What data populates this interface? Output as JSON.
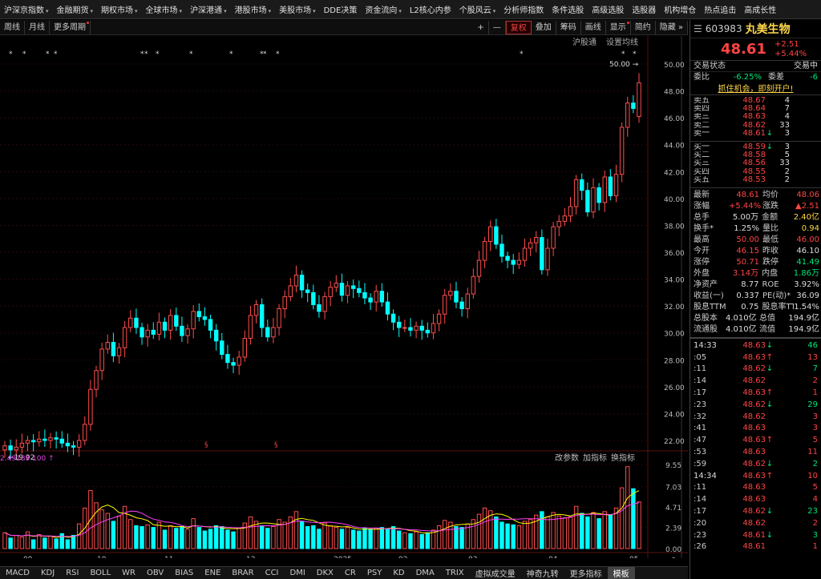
{
  "nav": [
    {
      "label": "沪深京指数",
      "dd": true
    },
    {
      "label": "金融期货",
      "dd": true
    },
    {
      "label": "期权市场",
      "dd": true
    },
    {
      "label": "全球市场",
      "dd": true
    },
    {
      "label": "沪深港通",
      "dd": true
    },
    {
      "label": "港股市场",
      "dd": true
    },
    {
      "label": "美股市场",
      "dd": true
    },
    {
      "label": "DDE决策",
      "dd": false
    },
    {
      "label": "资金流向",
      "dd": true
    },
    {
      "label": "L2核心内参",
      "dd": false
    },
    {
      "label": "个股风云",
      "dd": true
    },
    {
      "label": "分析师指数",
      "dd": false
    },
    {
      "label": "条件选股",
      "dd": false
    },
    {
      "label": "高级选股",
      "dd": false
    },
    {
      "label": "选股器",
      "dd": false
    },
    {
      "label": "机构增仓",
      "dd": false
    },
    {
      "label": "热点追击",
      "dd": false
    },
    {
      "label": "高成长性",
      "dd": false
    }
  ],
  "toolbar": {
    "left": [
      "周线",
      "月线",
      "更多周期"
    ],
    "right": [
      "+",
      "—",
      "复权",
      "叠加",
      "筹码",
      "画线",
      "显示",
      "简约",
      "隐藏 »"
    ]
  },
  "chart": {
    "label_shgt": "沪股通",
    "label_ma": "设置均线",
    "high_label": "50.00",
    "low_label": "19.92",
    "price_ticks": [
      "50.00",
      "48.00",
      "46.00",
      "44.00",
      "42.00",
      "40.00",
      "38.00",
      "36.00",
      "34.00",
      "32.00",
      "30.00",
      "28.00",
      "26.00",
      "24.00",
      "22.00"
    ],
    "price_values": [
      50,
      48,
      46,
      44,
      42,
      40,
      38,
      36,
      34,
      32,
      30,
      28,
      26,
      24,
      22
    ],
    "vol_ticks": [
      "9.55",
      "7.03",
      "4.71",
      "2.39",
      "0.00"
    ],
    "vol_values": [
      9.55,
      7.03,
      4.71,
      2.39,
      0
    ],
    "vol_indicator": "2.49189 100",
    "vol_buttons": [
      "改参数",
      "加指标",
      "换指标"
    ],
    "months": [
      "09",
      "10",
      "11",
      "12",
      "2025",
      "02",
      "03",
      "04",
      "05"
    ],
    "month_x": [
      35,
      127,
      211,
      313,
      422,
      503,
      590,
      690,
      791
    ]
  },
  "bottom_tabs": [
    "MACD",
    "KDJ",
    "RSI",
    "BOLL",
    "WR",
    "OBV",
    "BIAS",
    "ENE",
    "BRAR",
    "CCI",
    "DMI",
    "DKX",
    "CR",
    "PSY",
    "KD",
    "DMA",
    "TRIX",
    "虚拟成交量",
    "神奇九转",
    "更多指标",
    "模板"
  ],
  "quote": {
    "code": "603983",
    "name": "丸美生物",
    "price": "48.61",
    "change": "+2.51",
    "pct": "+5.44%",
    "status_label": "交易状态",
    "status_value": "交易中",
    "weibi_label": "委比",
    "weibi_value": "-6.25%",
    "weicha_label": "委差",
    "weicha_value": "-6",
    "banner": "抓住机会，即刻开户!",
    "asks": [
      {
        "label": "卖五",
        "price": "48.67",
        "vol": "4",
        "arrow": ""
      },
      {
        "label": "卖四",
        "price": "48.64",
        "vol": "7",
        "arrow": ""
      },
      {
        "label": "卖三",
        "price": "48.63",
        "vol": "4",
        "arrow": ""
      },
      {
        "label": "卖二",
        "price": "48.62",
        "vol": "33",
        "arrow": ""
      },
      {
        "label": "卖一",
        "price": "48.61",
        "vol": "3",
        "arrow": "↓"
      }
    ],
    "bids": [
      {
        "label": "买一",
        "price": "48.59",
        "vol": "3",
        "arrow": "↓"
      },
      {
        "label": "买二",
        "price": "48.58",
        "vol": "5",
        "arrow": ""
      },
      {
        "label": "买三",
        "price": "48.56",
        "vol": "33",
        "arrow": ""
      },
      {
        "label": "买四",
        "price": "48.55",
        "vol": "2",
        "arrow": ""
      },
      {
        "label": "买五",
        "price": "48.53",
        "vol": "2",
        "arrow": ""
      }
    ],
    "stats": [
      {
        "l1": "最新",
        "v1": "48.61",
        "c1": "red",
        "l2": "均价",
        "v2": "48.06",
        "c2": "red"
      },
      {
        "l1": "涨幅",
        "v1": "+5.44%",
        "c1": "red",
        "l2": "涨跌",
        "v2": "▲2.51",
        "c2": "red"
      },
      {
        "l1": "总手",
        "v1": "5.00万",
        "c1": "wht",
        "l2": "金额",
        "v2": "2.40亿",
        "c2": "yel"
      },
      {
        "l1": "换手*",
        "v1": "1.25%",
        "c1": "wht",
        "l2": "量比",
        "v2": "0.94",
        "c2": "yel"
      },
      {
        "l1": "最高",
        "v1": "50.00",
        "c1": "red",
        "l2": "最低",
        "v2": "46.00",
        "c2": "red"
      },
      {
        "l1": "今开",
        "v1": "46.15",
        "c1": "red",
        "l2": "昨收",
        "v2": "46.10",
        "c2": "wht"
      },
      {
        "l1": "涨停",
        "v1": "50.71",
        "c1": "red",
        "l2": "跌停",
        "v2": "41.49",
        "c2": "grn"
      },
      {
        "l1": "外盘",
        "v1": "3.14万",
        "c1": "red",
        "l2": "内盘",
        "v2": "1.86万",
        "c2": "grn"
      },
      {
        "l1": "净资产",
        "v1": "8.77",
        "c1": "wht",
        "l2": "ROE",
        "v2": "3.92%",
        "c2": "wht"
      },
      {
        "l1": "收益(一)",
        "v1": "0.337",
        "c1": "wht",
        "l2": "PE(动)*",
        "v2": "36.09",
        "c2": "wht"
      },
      {
        "l1": "股息TTM",
        "v1": "0.75",
        "c1": "wht",
        "l2": "股息率TTM",
        "v2": "1.54%",
        "c2": "wht"
      },
      {
        "l1": "总股本",
        "v1": "4.010亿",
        "c1": "wht",
        "l2": "总值",
        "v2": "194.9亿",
        "c2": "wht"
      },
      {
        "l1": "流通股",
        "v1": "4.010亿",
        "c1": "wht",
        "l2": "流值",
        "v2": "194.9亿",
        "c2": "wht"
      }
    ],
    "trades": [
      {
        "t": "14:33",
        "p": "48.63",
        "a": "↓",
        "v": "46"
      },
      {
        "t": ":05",
        "p": "48.63",
        "a": "↑",
        "v": "13"
      },
      {
        "t": ":11",
        "p": "48.62",
        "a": "↓",
        "v": "7"
      },
      {
        "t": ":14",
        "p": "48.62",
        "a": "",
        "v": "2"
      },
      {
        "t": ":17",
        "p": "48.63",
        "a": "↑",
        "v": "1"
      },
      {
        "t": ":23",
        "p": "48.62",
        "a": "↓",
        "v": "29"
      },
      {
        "t": ":32",
        "p": "48.62",
        "a": "",
        "v": "3"
      },
      {
        "t": ":41",
        "p": "48.63",
        "a": "",
        "v": "3"
      },
      {
        "t": ":47",
        "p": "48.63",
        "a": "↑",
        "v": "5"
      },
      {
        "t": ":53",
        "p": "48.63",
        "a": "",
        "v": "11"
      },
      {
        "t": ":59",
        "p": "48.62",
        "a": "↓",
        "v": "2"
      },
      {
        "t": "14:34",
        "p": "48.63",
        "a": "↑",
        "v": "10"
      },
      {
        "t": ":11",
        "p": "48.63",
        "a": "",
        "v": "5"
      },
      {
        "t": ":14",
        "p": "48.63",
        "a": "",
        "v": "4"
      },
      {
        "t": ":17",
        "p": "48.62",
        "a": "↓",
        "v": "23"
      },
      {
        "t": ":20",
        "p": "48.62",
        "a": "",
        "v": "2"
      },
      {
        "t": ":23",
        "p": "48.61",
        "a": "↓",
        "v": "3"
      },
      {
        "t": ":26",
        "p": "48.61",
        "a": "",
        "v": "1"
      }
    ]
  },
  "chart_data": {
    "type": "candlestick",
    "price_axis": [
      22,
      50
    ],
    "volume_axis": [
      0,
      9.55
    ],
    "closes": [
      21.6,
      21.3,
      21.5,
      21.8,
      22.0,
      21.9,
      22.1,
      22.0,
      22.2,
      22.1,
      21.8,
      21.6,
      21.5,
      22.0,
      23.2,
      25.8,
      27.2,
      28.8,
      29.3,
      28.3,
      28.9,
      30.4,
      31.1,
      30.4,
      29.7,
      30.2,
      29.9,
      30.8,
      30.2,
      31.3,
      30.5,
      29.8,
      30.3,
      31.6,
      31.2,
      31.0,
      30.2,
      29.4,
      28.4,
      27.8,
      27.6,
      28.2,
      29.6,
      31.3,
      32.1,
      30.4,
      29.7,
      30.4,
      31.8,
      32.7,
      33.5,
      34.3,
      33.2,
      33.0,
      32.1,
      31.6,
      32.7,
      33.4,
      33.7,
      32.8,
      33.5,
      33.3,
      33.0,
      32.6,
      32.3,
      33.1,
      32.3,
      31.4,
      30.8,
      30.4,
      30.4,
      30.2,
      30.5,
      30.2,
      30.0,
      30.7,
      31.4,
      32.8,
      33.1,
      32.3,
      31.8,
      32.9,
      34.2,
      35.4,
      36.8,
      37.9,
      36.6,
      35.7,
      35.4,
      35.1,
      35.4,
      36.3,
      36.7,
      37.1,
      34.7,
      36.3,
      37.9,
      38.3,
      38.7,
      39.4,
      41.4,
      40.6,
      39.0,
      40.8,
      39.7,
      41.6,
      40.2,
      41.8,
      45.3,
      47.1,
      46.7,
      48.61
    ],
    "opens": [
      21.3,
      21.6,
      21.3,
      21.5,
      21.8,
      22.0,
      21.9,
      22.1,
      22.0,
      22.2,
      22.1,
      21.8,
      21.6,
      21.5,
      22.0,
      23.2,
      25.8,
      27.2,
      28.8,
      29.3,
      28.3,
      28.9,
      30.4,
      31.1,
      30.4,
      29.7,
      30.2,
      29.9,
      30.8,
      30.2,
      31.3,
      30.5,
      29.8,
      30.3,
      31.6,
      31.2,
      31.0,
      30.2,
      29.4,
      28.4,
      27.8,
      27.6,
      28.2,
      29.6,
      31.3,
      32.1,
      30.4,
      29.7,
      30.4,
      31.8,
      32.7,
      33.5,
      34.3,
      33.2,
      33.0,
      32.1,
      31.6,
      32.7,
      33.4,
      33.7,
      32.8,
      33.5,
      33.3,
      33.0,
      32.6,
      32.3,
      33.1,
      32.3,
      31.4,
      30.8,
      30.4,
      30.4,
      30.2,
      30.5,
      30.2,
      30.0,
      30.7,
      31.4,
      32.8,
      33.1,
      32.3,
      31.8,
      32.9,
      34.2,
      35.4,
      36.8,
      37.9,
      36.6,
      35.7,
      35.4,
      35.1,
      35.4,
      36.3,
      36.7,
      37.1,
      34.7,
      36.3,
      37.9,
      38.3,
      38.7,
      39.4,
      41.4,
      40.6,
      39.0,
      40.8,
      39.7,
      41.6,
      40.2,
      41.8,
      45.3,
      47.1,
      46.1
    ],
    "volumes": [
      1.8,
      1.2,
      1.5,
      1.3,
      1.9,
      1.0,
      1.6,
      1.2,
      1.4,
      1.1,
      1.7,
      1.0,
      1.5,
      2.8,
      4.6,
      6.6,
      5.2,
      4.4,
      4.0,
      3.1,
      3.7,
      4.8,
      3.3,
      2.6,
      2.5,
      2.7,
      2.4,
      3.0,
      2.1,
      2.6,
      2.3,
      2.5,
      2.2,
      3.4,
      2.4,
      2.0,
      2.2,
      2.6,
      2.5,
      2.1,
      1.9,
      2.3,
      2.9,
      3.6,
      3.1,
      2.6,
      2.3,
      2.5,
      3.3,
      3.0,
      3.6,
      4.2,
      3.1,
      2.5,
      2.6,
      2.2,
      2.9,
      2.6,
      2.4,
      2.2,
      2.4,
      2.1,
      2.0,
      2.3,
      2.2,
      2.3,
      2.4,
      2.2,
      2.5,
      2.0,
      1.8,
      1.7,
      1.9,
      1.6,
      1.8,
      2.1,
      2.6,
      3.2,
      3.0,
      2.5,
      2.4,
      2.8,
      3.3,
      3.9,
      4.6,
      4.3,
      3.6,
      3.0,
      2.8,
      2.7,
      2.6,
      3.1,
      3.3,
      3.8,
      4.2,
      3.6,
      4.1,
      3.7,
      3.5,
      3.6,
      4.8,
      4.0,
      3.6,
      4.1,
      3.4,
      4.2,
      3.8,
      4.6,
      6.9,
      9.3,
      6.8,
      5.3
    ]
  }
}
